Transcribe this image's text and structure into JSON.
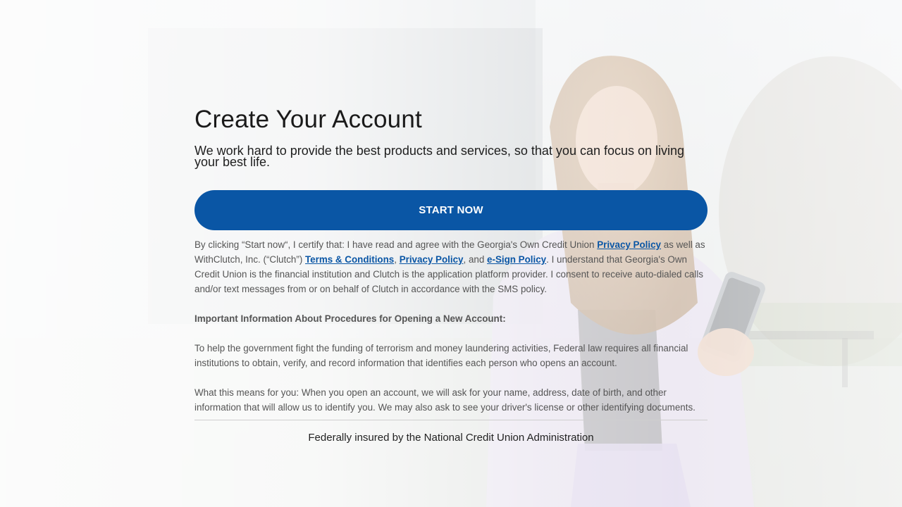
{
  "page": {
    "title": "Create Your Account",
    "subtitle": "We work hard to provide the best products and services, so that you can focus on living your best life."
  },
  "cta": {
    "start_label": "START NOW"
  },
  "disclosure": {
    "p1_part1": "By clicking “Start now“, I certify that: I have read and agree with the Georgia's Own Credit Union ",
    "link_privacy_1": "Privacy Policy",
    "p1_part2": " as well as WithClutch, Inc. (“Clutch”) ",
    "link_terms": "Terms & Conditions",
    "p1_comma": ", ",
    "link_privacy_2": "Privacy Policy",
    "p1_and": ", and ",
    "link_esign": "e-Sign Policy",
    "p1_part3": ". I understand that Georgia's Own Credit Union is the financial institution and Clutch is the application platform provider. I consent to receive auto-dialed calls and/or text messages from or on behalf of Clutch in accordance with the SMS policy.",
    "important_heading": "Important Information About Procedures for Opening a New Account:",
    "p2": "To help the government fight the funding of terrorism and money laundering activities, Federal law requires all financial institutions to obtain, verify, and record information that identifies each person who opens an account.",
    "p3": "What this means for you: When you open an account, we will ask for your name, address, date of birth, and other information that will allow us to identify you. We may also ask to see your driver's license or other identifying documents."
  },
  "footer": {
    "ncua_note": "Federally insured by the National Credit Union Administration"
  },
  "colors": {
    "primary": "#0a56a5",
    "text": "#222222",
    "muted_text": "#555555"
  }
}
